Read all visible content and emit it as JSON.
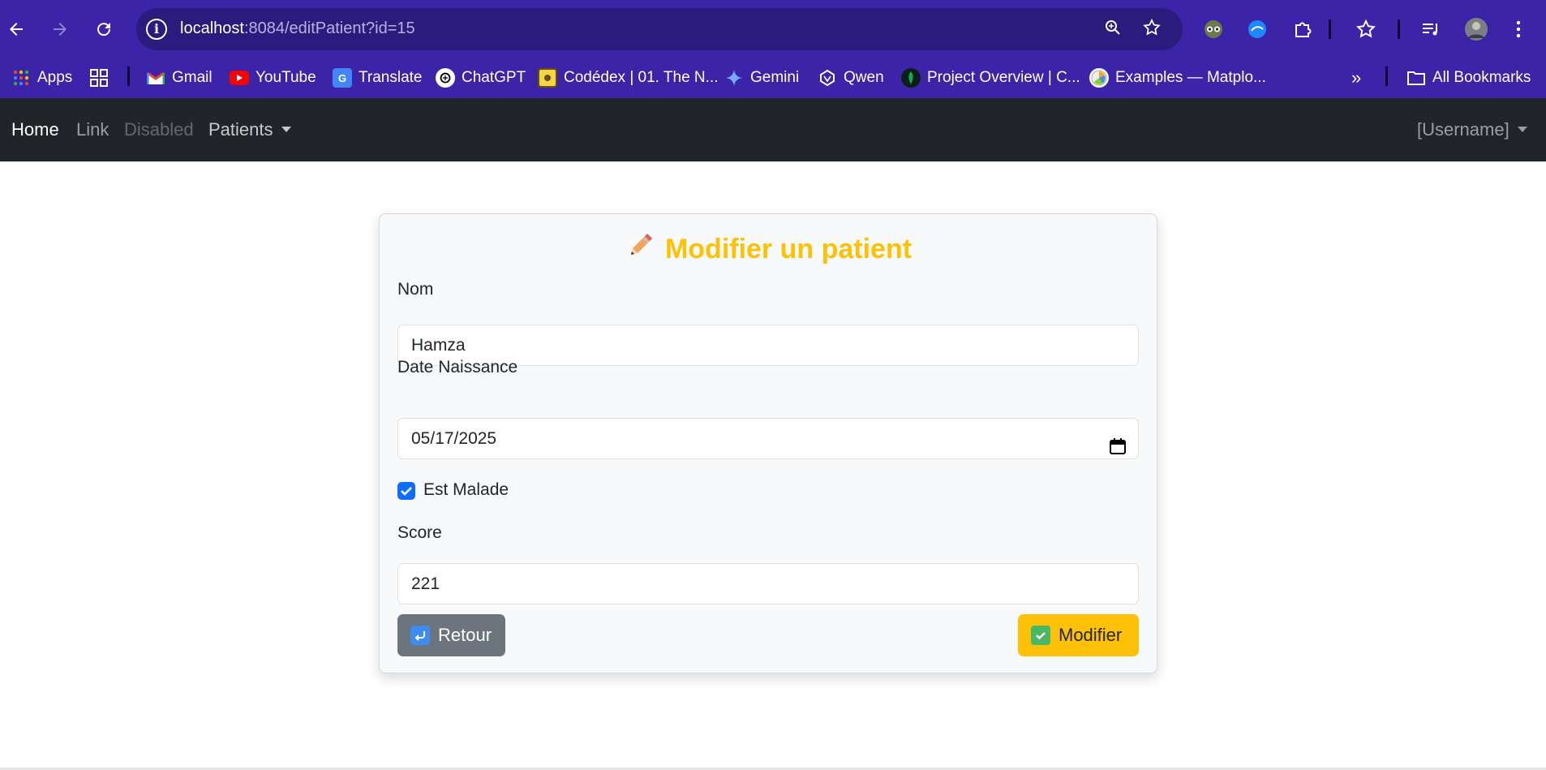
{
  "browser": {
    "url_host": "localhost",
    "url_rest": ":8084/editPatient?id=15",
    "bookmarks": [
      {
        "label": "Apps",
        "icon": "apps-grid-icon"
      },
      {
        "label": "Gmail",
        "icon": "gmail-icon"
      },
      {
        "label": "YouTube",
        "icon": "youtube-icon"
      },
      {
        "label": "Translate",
        "icon": "translate-icon"
      },
      {
        "label": "ChatGPT",
        "icon": "chatgpt-icon"
      },
      {
        "label": "Codédex | 01. The N...",
        "icon": "codedex-icon"
      },
      {
        "label": "Gemini",
        "icon": "gemini-icon"
      },
      {
        "label": "Qwen",
        "icon": "qwen-icon"
      },
      {
        "label": "Project Overview | C...",
        "icon": "mongodb-icon"
      },
      {
        "label": "Examples — Matplo...",
        "icon": "matplotlib-icon"
      }
    ],
    "all_bookmarks": "All Bookmarks",
    "overflow": "»"
  },
  "navbar": {
    "home": "Home",
    "link": "Link",
    "disabled": "Disabled",
    "patients": "Patients",
    "username": "[Username]"
  },
  "form": {
    "title": "Modifier un patient",
    "nom_label": "Nom",
    "nom_value": "Hamza",
    "date_label": "Date Naissance",
    "date_value": "05/17/2025",
    "malade_label": "Est Malade",
    "malade_checked": true,
    "score_label": "Score",
    "score_value": "221",
    "back_button": "Retour",
    "submit_button": "Modifier"
  },
  "colors": {
    "browser_chrome": "#3b24a8",
    "navbar_bg": "#212529",
    "title_color": "#ffc107",
    "primary": "#0d6efd"
  }
}
